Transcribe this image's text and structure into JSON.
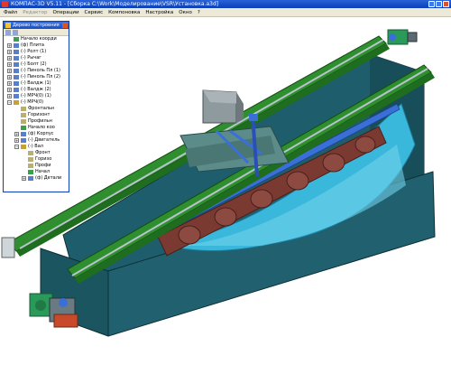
{
  "window": {
    "title": "КОМПАС-3D V5.11 - [Сборка C:\\Work\\Моделирование\\VSR\\Установка.a3d]"
  },
  "menu": [
    "Файл",
    "Редактор",
    "Операции",
    "Сервис",
    "Компоновка",
    "Настройка",
    "Окно",
    "?"
  ],
  "tree": {
    "title": "Дерево построения",
    "items": [
      {
        "label": "Начало коорди",
        "icon": "coord",
        "level": 0
      },
      {
        "label": "(ф) Плита",
        "icon": "part",
        "level": 0
      },
      {
        "label": "(-) Ролт (1)",
        "icon": "part",
        "level": 0
      },
      {
        "label": "(-) Рычаг",
        "icon": "part",
        "level": 0
      },
      {
        "label": "(-) Болт (2)",
        "icon": "part",
        "level": 0
      },
      {
        "label": "(-) Пиноль Пл (1)",
        "icon": "part",
        "level": 0
      },
      {
        "label": "(-) Пиноль Пл (2)",
        "icon": "part",
        "level": 0
      },
      {
        "label": "(-) Валдж (1)",
        "icon": "part",
        "level": 0
      },
      {
        "label": "(-) Валдж (2)",
        "icon": "part",
        "level": 0
      },
      {
        "label": "(-) МРЧ(0) (1)",
        "icon": "part",
        "level": 0
      },
      {
        "label": "(-) МРЧ(0)",
        "icon": "asm",
        "level": 0
      },
      {
        "label": "Фронтальн",
        "icon": "plane",
        "level": 1
      },
      {
        "label": "Горизонт",
        "icon": "plane",
        "level": 1
      },
      {
        "label": "Профильн",
        "icon": "plane",
        "level": 1
      },
      {
        "label": "Начало коо",
        "icon": "coord",
        "level": 1
      },
      {
        "label": "(ф) Корпус",
        "icon": "part",
        "level": 1
      },
      {
        "label": "(-) Двигатель",
        "icon": "part",
        "level": 1
      },
      {
        "label": "(-) Вал",
        "icon": "asm",
        "level": 1
      },
      {
        "label": "Фронт",
        "icon": "plane",
        "level": 2
      },
      {
        "label": "Горизо",
        "icon": "plane",
        "level": 2
      },
      {
        "label": "Профи",
        "icon": "plane",
        "level": 2
      },
      {
        "label": "Начал",
        "icon": "coord",
        "level": 2
      },
      {
        "label": "(ф) Детали",
        "icon": "part",
        "level": 2
      }
    ]
  },
  "colors": {
    "tank_wall": "#1c5a66",
    "tank_dark": "#0f3a44",
    "rail": "#2f8f2f",
    "water": "#37b4d8",
    "drum": "#7a3a32",
    "beam": "#5c7c8c",
    "motor": "#2a9a5a",
    "accent": "#3a6fd8"
  }
}
